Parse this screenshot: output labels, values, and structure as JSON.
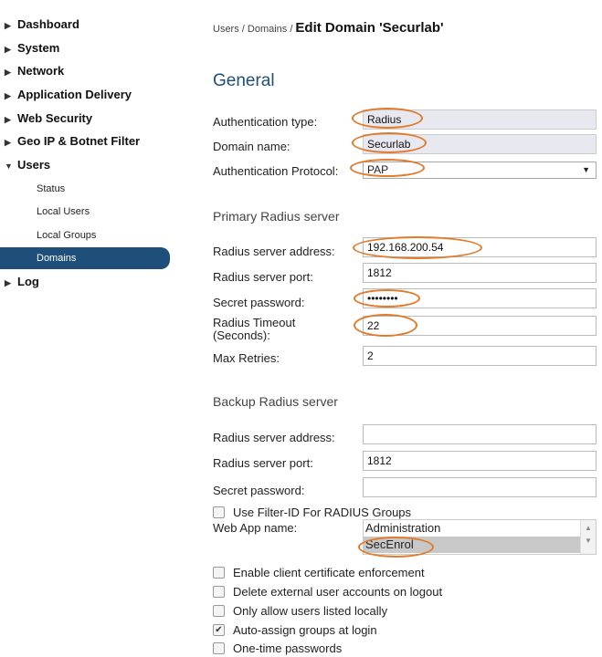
{
  "sidebar": {
    "items": [
      {
        "label": "Dashboard"
      },
      {
        "label": "System"
      },
      {
        "label": "Network"
      },
      {
        "label": "Application Delivery"
      },
      {
        "label": "Web Security"
      },
      {
        "label": "Geo IP & Botnet Filter"
      },
      {
        "label": "Users"
      },
      {
        "label": "Log"
      }
    ],
    "users_sub": [
      {
        "label": "Status"
      },
      {
        "label": "Local Users"
      },
      {
        "label": "Local Groups"
      },
      {
        "label": "Domains"
      }
    ]
  },
  "header": {
    "breadcrumb": "Users / Domains /",
    "title": "Edit Domain 'Securlab'"
  },
  "general": {
    "title": "General",
    "auth_type_label": "Authentication type:",
    "auth_type_value": "Radius",
    "domain_name_label": "Domain name:",
    "domain_name_value": "Securlab",
    "auth_protocol_label": "Authentication Protocol:",
    "auth_protocol_value": "PAP"
  },
  "primary": {
    "title": "Primary Radius server",
    "address_label": "Radius server address:",
    "address_value": "192.168.200.54",
    "port_label": "Radius server port:",
    "port_value": "1812",
    "secret_label": "Secret password:",
    "secret_value": "••••••••",
    "timeout_label": "Radius Timeout (Seconds):",
    "timeout_value": "22",
    "retries_label": "Max Retries:",
    "retries_value": "2"
  },
  "backup": {
    "title": "Backup Radius server",
    "address_label": "Radius server address:",
    "address_value": "",
    "port_label": "Radius server port:",
    "port_value": "1812",
    "secret_label": "Secret password:",
    "secret_value": ""
  },
  "options": {
    "filter_id_label": "Use Filter-ID For RADIUS Groups",
    "webapp_label": "Web App name:",
    "webapp_options": [
      "Administration",
      "SecEnrol"
    ],
    "checks": [
      {
        "label": "Enable client certificate enforcement",
        "checked": false
      },
      {
        "label": "Delete external user accounts on logout",
        "checked": false
      },
      {
        "label": "Only allow users listed locally",
        "checked": false
      },
      {
        "label": "Auto-assign groups at login",
        "checked": true
      },
      {
        "label": "One-time passwords",
        "checked": false
      }
    ]
  },
  "colors": {
    "accent": "#1e4f7a",
    "highlight": "#e27a2a"
  }
}
